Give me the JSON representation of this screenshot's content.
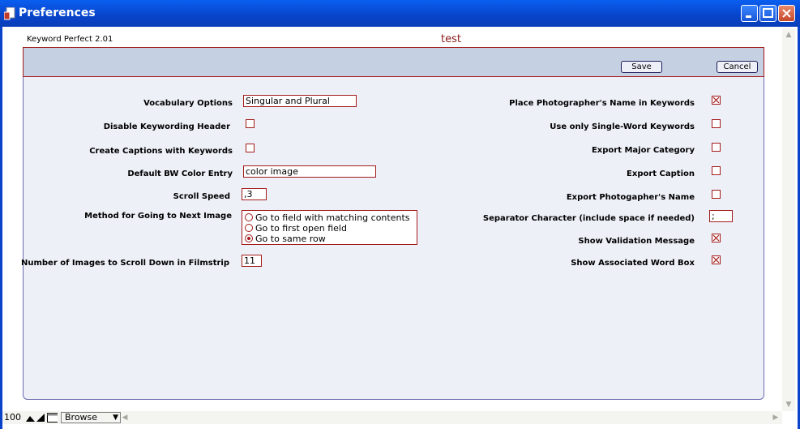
{
  "window": {
    "title": "Preferences"
  },
  "header": {
    "app_version": "Keyword Perfect 2.01",
    "layout_name": "test"
  },
  "toolbar": {
    "save_label": "Save",
    "cancel_label": "Cancel"
  },
  "left": {
    "vocabulary_label": "Vocabulary Options",
    "vocabulary_value": "Singular and Plural",
    "disable_header_label": "Disable Keywording Header",
    "disable_header_checked": false,
    "captions_label": "Create Captions with Keywords",
    "captions_checked": false,
    "bw_color_label": "Default BW Color Entry",
    "bw_color_value": "color image",
    "scroll_speed_label": "Scroll Speed",
    "scroll_speed_value": ",3",
    "next_image_label": "Method for Going to Next Image",
    "next_image_options": [
      "Go to field with matching contents",
      "Go to first open field",
      "Go to same row"
    ],
    "next_image_selected": 2,
    "filmstrip_label": "Number of Images to Scroll Down in Filmstrip",
    "filmstrip_value": "11"
  },
  "right": {
    "photographer_name_label": "Place Photographer's Name in Keywords",
    "photographer_name_checked": true,
    "single_word_label": "Use only Single-Word Keywords",
    "single_word_checked": false,
    "major_category_label": "Export Major Category",
    "major_category_checked": false,
    "caption_label": "Export Caption",
    "caption_checked": false,
    "photogapher_export_label": "Export Photogapher's Name",
    "photogapher_export_checked": false,
    "separator_label": "Separator Character (include space if needed)",
    "separator_value": ";",
    "validation_label": "Show Validation Message",
    "validation_checked": true,
    "assoc_label": "Show Associated Word Box",
    "assoc_checked": true
  },
  "statusbar": {
    "zoom": "100",
    "mode": "Browse"
  },
  "colors": {
    "titlebar": "#0a5ff0",
    "accent": "#a31b1b",
    "panel": "#eef0f8",
    "panel_header": "#c5d0e2"
  }
}
